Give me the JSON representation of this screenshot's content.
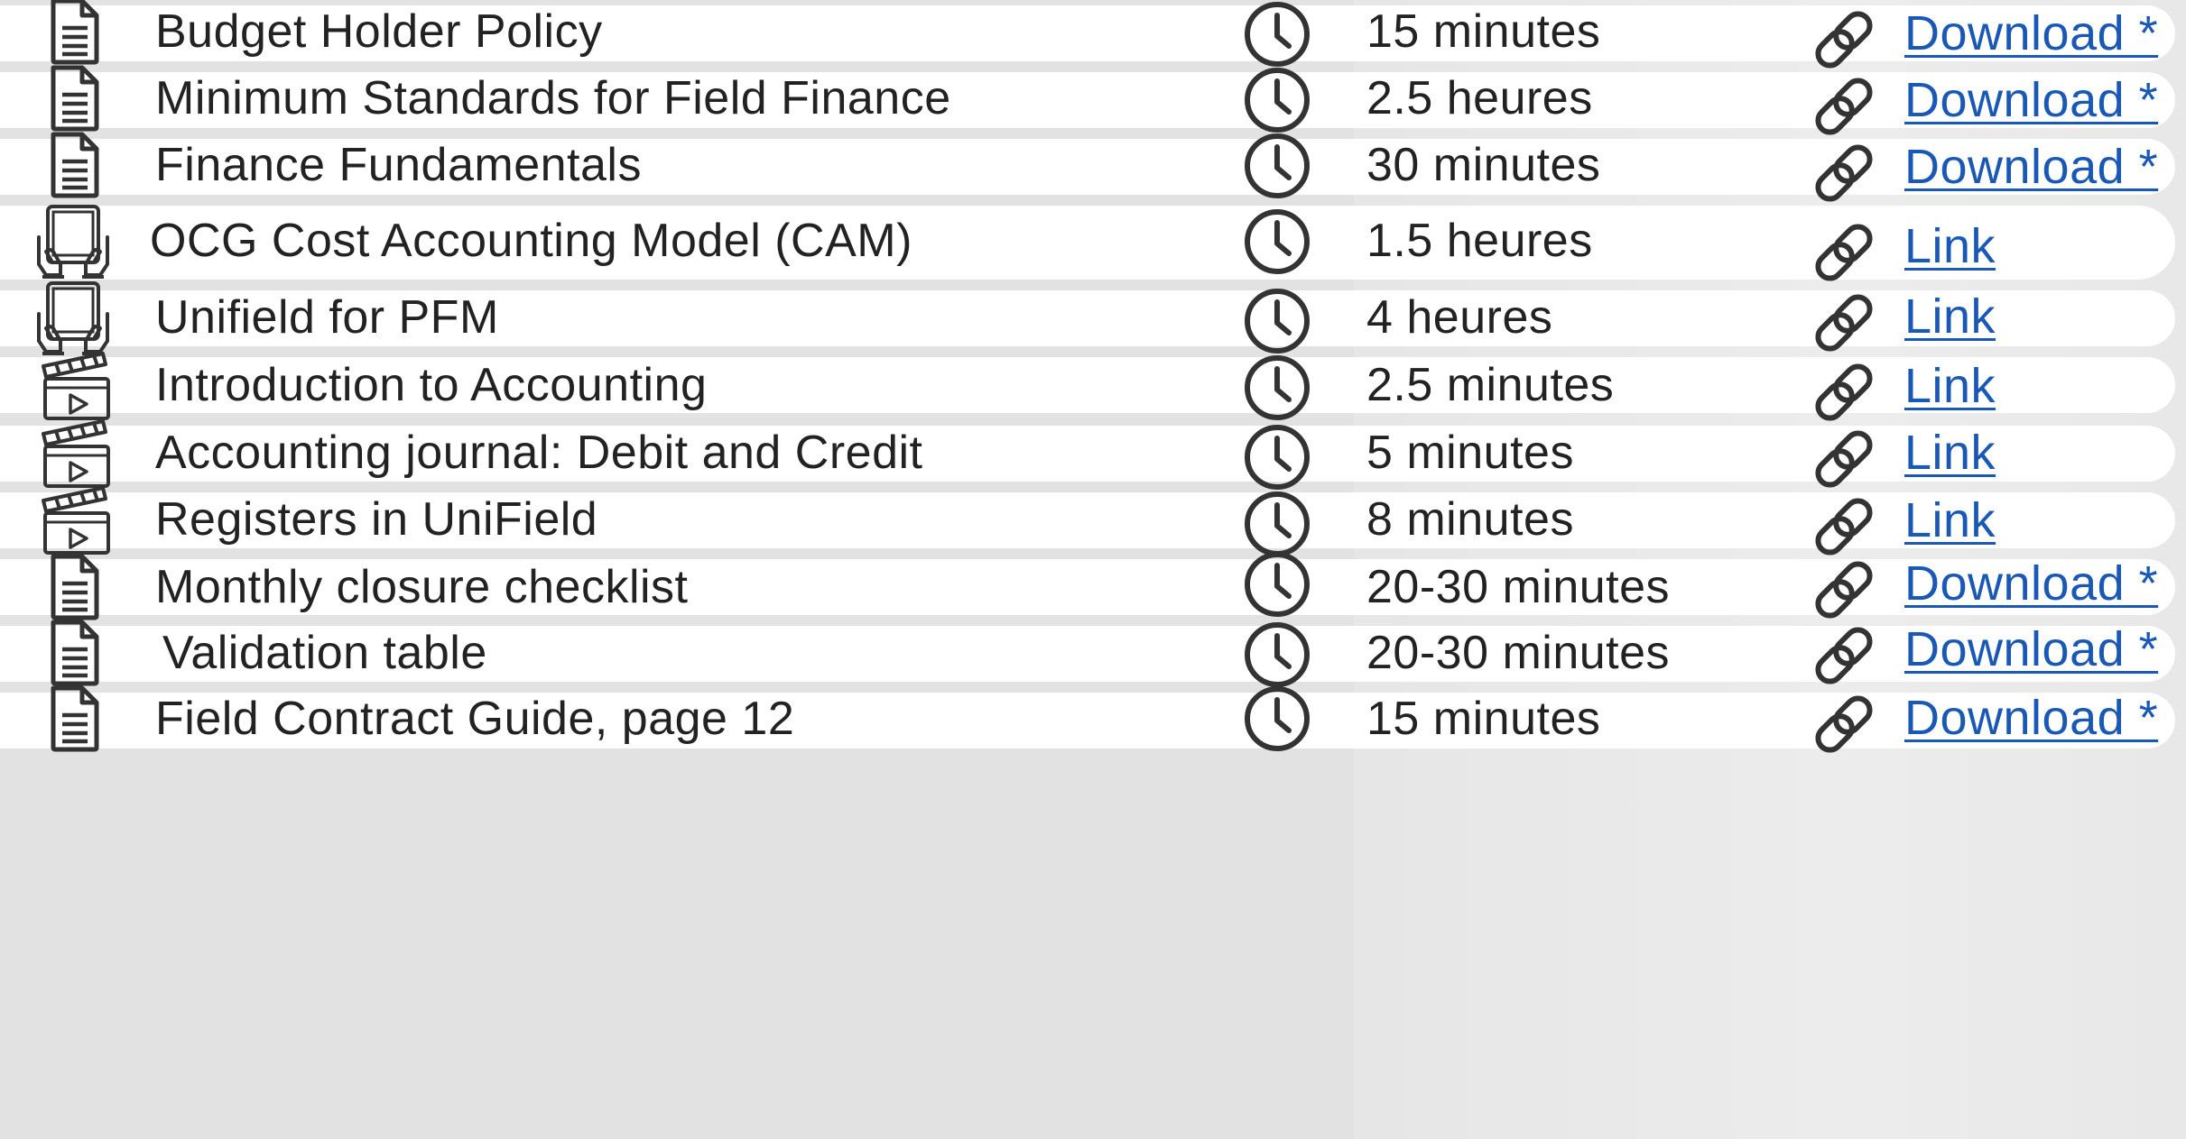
{
  "theme": {
    "text_color": "#222222",
    "link_color": "#1a58b5",
    "icon_color": "#333333",
    "row_bg": "#ffffff",
    "page_bg": "#e2e2e2"
  },
  "resources": [
    {
      "icon": "document-icon",
      "title": "Budget Holder Policy",
      "duration": "15 minutes",
      "action": "Download *"
    },
    {
      "icon": "document-icon",
      "title": "Minimum Standards for Field Finance",
      "duration": "2.5 heures",
      "action": "Download *"
    },
    {
      "icon": "document-icon",
      "title": "Finance Fundamentals",
      "duration": "30 minutes",
      "action": "Download *"
    },
    {
      "icon": "tablet-hands-icon",
      "title": "OCG Cost Accounting Model (CAM)",
      "duration": "1.5 heures",
      "action": "Link"
    },
    {
      "icon": "tablet-hands-icon",
      "title": "Unifield for PFM",
      "duration": "4 heures",
      "action": "Link"
    },
    {
      "icon": "video-clapper-icon",
      "title": "Introduction to Accounting",
      "duration": "2.5 minutes",
      "action": "Link"
    },
    {
      "icon": "video-clapper-icon",
      "title": "Accounting journal: Debit and Credit",
      "duration": "5 minutes",
      "action": "Link"
    },
    {
      "icon": "video-clapper-icon",
      "title": "Registers in UniField",
      "duration": "8 minutes",
      "action": "Link"
    },
    {
      "icon": "document-icon",
      "title": "Monthly closure checklist",
      "duration": "20-30 minutes",
      "action": "Download *"
    },
    {
      "icon": "document-icon",
      "title": "Validation table",
      "duration": "20-30 minutes",
      "action": "Download *"
    },
    {
      "icon": "document-icon",
      "title": "Field Contract Guide, page 12",
      "duration": "15 minutes",
      "action": "Download *"
    }
  ]
}
